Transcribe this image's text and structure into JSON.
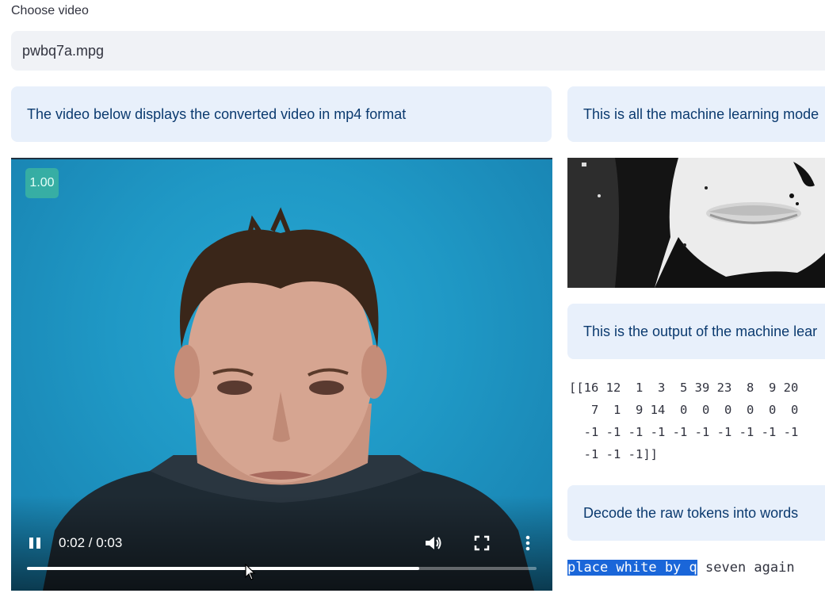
{
  "select": {
    "label": "Choose video",
    "value": "pwbq7a.mpg"
  },
  "info": {
    "video_caption": "The video below displays the converted video in mp4 format",
    "model_input_caption": "This is all the machine learning mode",
    "model_output_caption": "This is the output of the machine lear",
    "decode_caption": "Decode the raw tokens into words"
  },
  "video": {
    "speed": "1.00",
    "time": "0:02 / 0:03",
    "progress": 0.77,
    "icons": {
      "pause": "pause-icon",
      "volume": "volume-icon",
      "fullscreen": "fullscreen-icon",
      "more": "more-vert-icon"
    }
  },
  "tokens": {
    "line1": "[[16 12  1  3  5 39 23  8  9 20",
    "line2": "   7  1  9 14  0  0  0  0  0  0",
    "line3": "  -1 -1 -1 -1 -1 -1 -1 -1 -1 -1",
    "line4": "  -1 -1 -1]]"
  },
  "decoded": {
    "highlighted": "place white by q",
    "rest": " seven again"
  },
  "colors": {
    "info_bg": "#e8f0fb",
    "info_text": "#0b3a6f",
    "select_bg": "#f0f2f6",
    "highlight": "#1a66d9",
    "video_bg": "#1f98c5"
  }
}
